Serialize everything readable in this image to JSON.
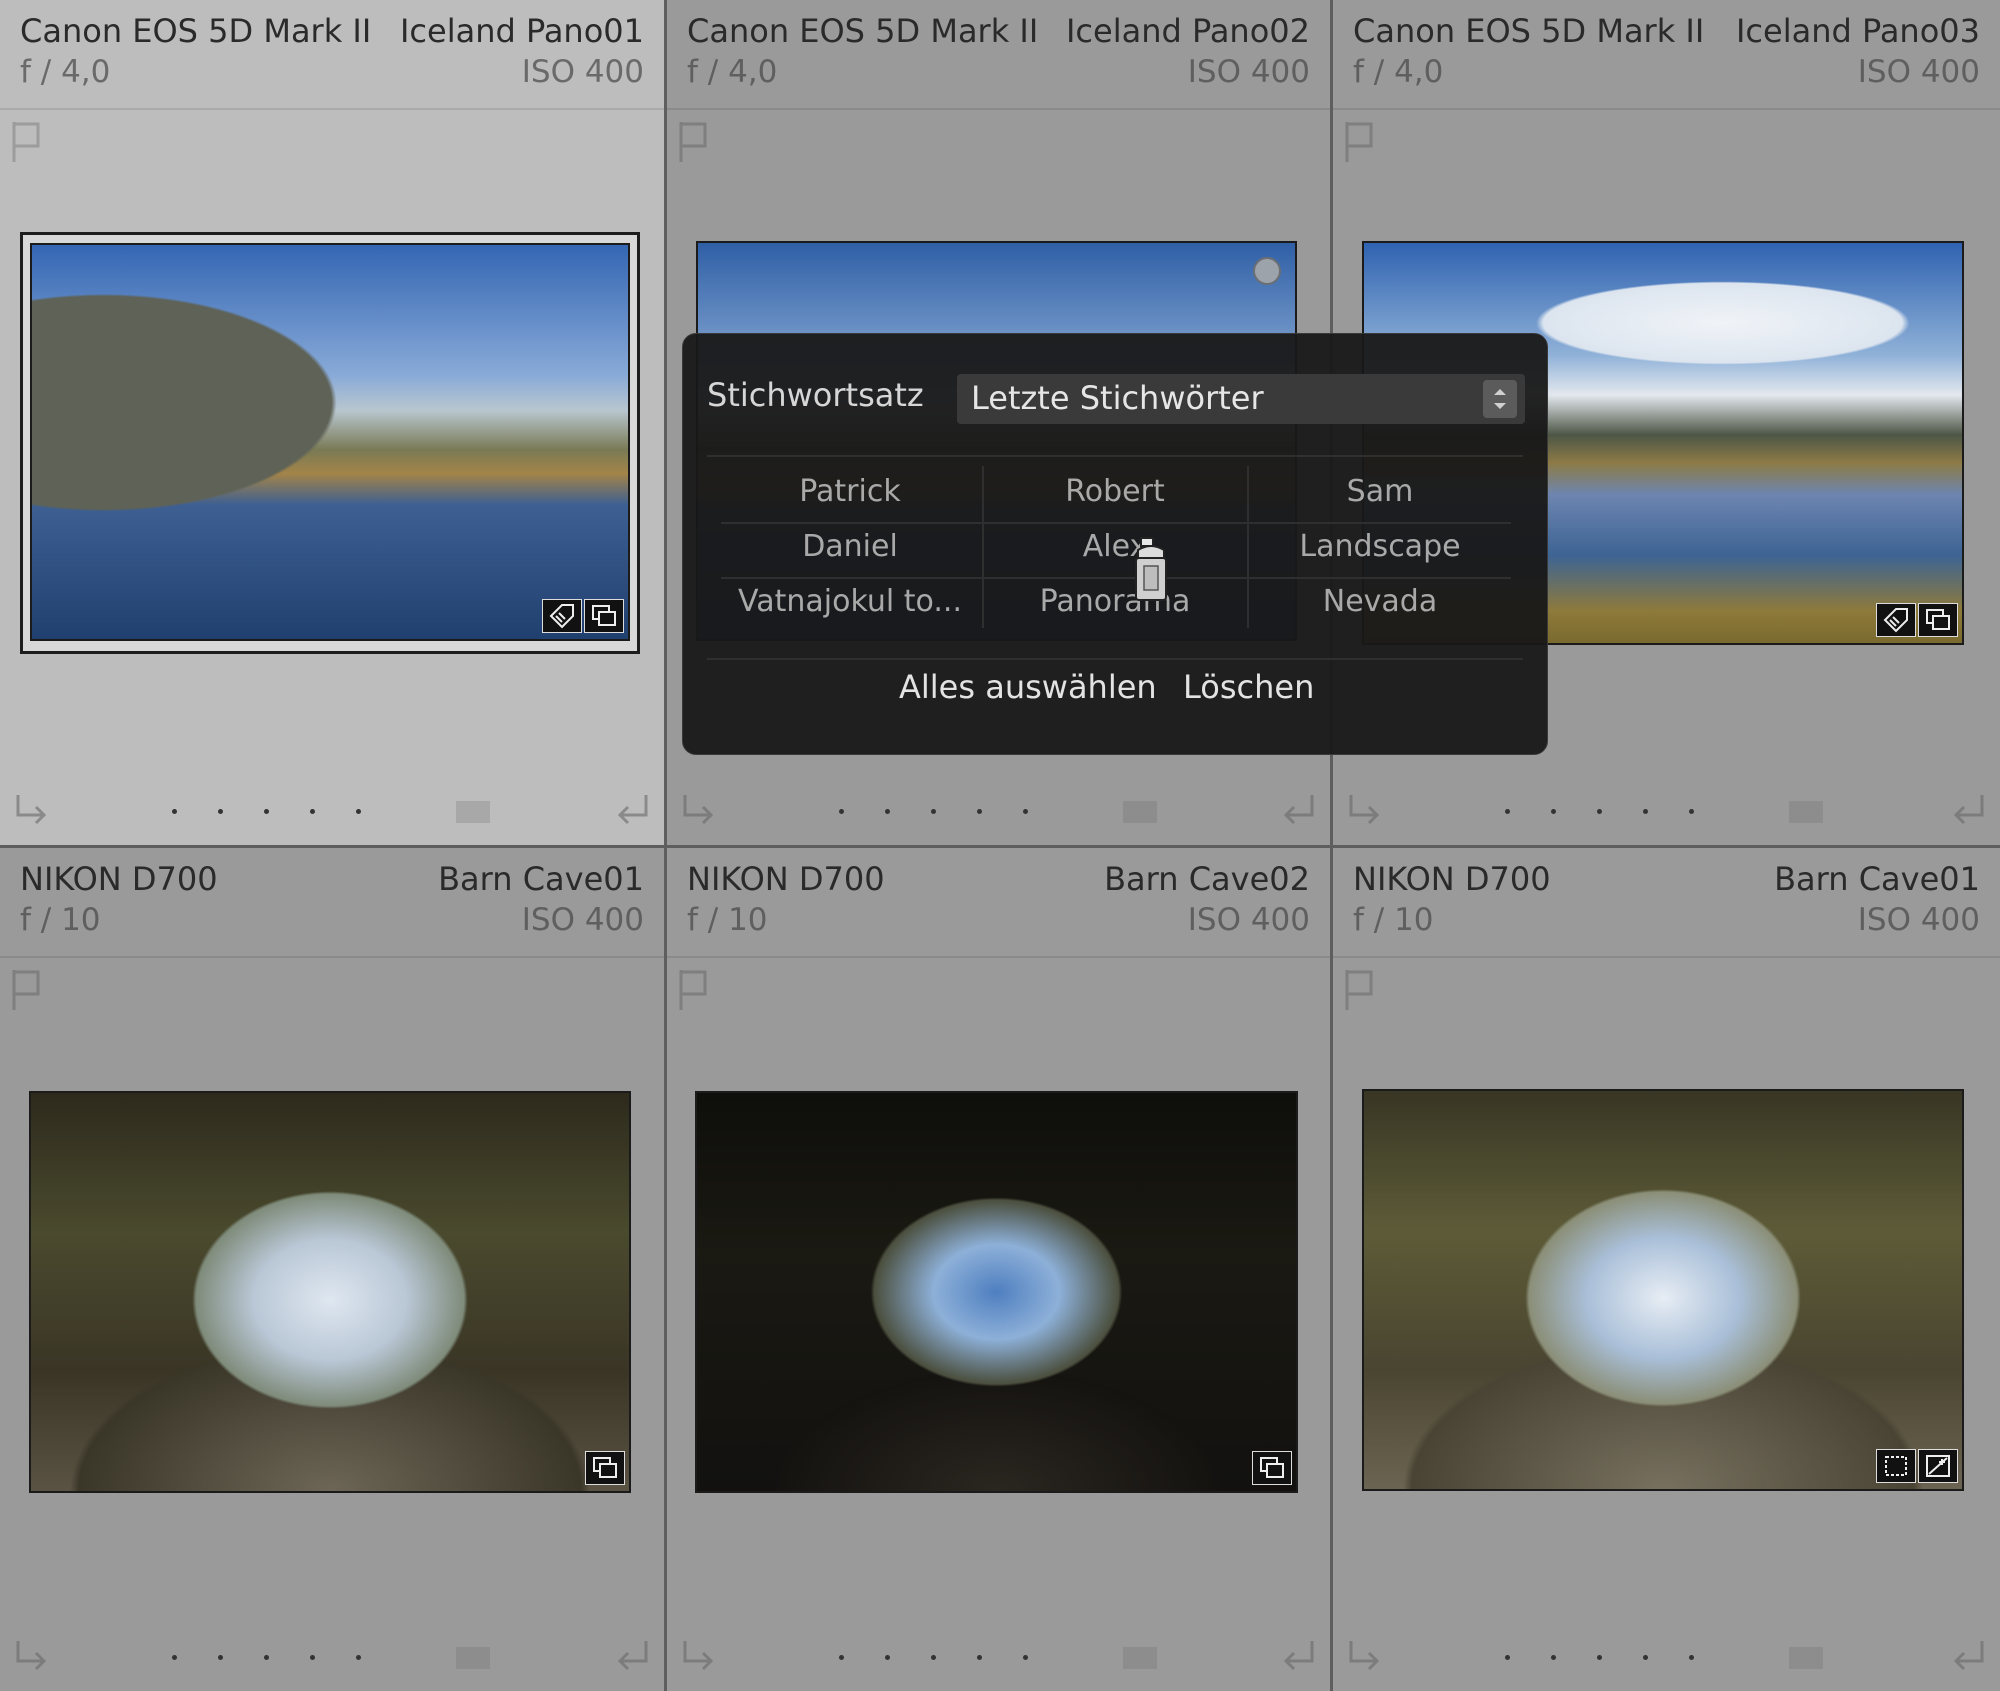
{
  "grid": {
    "cells": [
      {
        "camera": "Canon EOS 5D Mark II",
        "name": "Iceland Pano01",
        "aperture": "f / 4,0",
        "iso": "ISO 400"
      },
      {
        "camera": "Canon EOS 5D Mark II",
        "name": "Iceland Pano02",
        "aperture": "f / 4,0",
        "iso": "ISO 400"
      },
      {
        "camera": "Canon EOS 5D Mark II",
        "name": "Iceland Pano03",
        "aperture": "f / 4,0",
        "iso": "ISO 400"
      },
      {
        "camera": "NIKON D700",
        "name": "Barn Cave01",
        "aperture": "f / 10",
        "iso": "ISO 400"
      },
      {
        "camera": "NIKON D700",
        "name": "Barn Cave02",
        "aperture": "f / 10",
        "iso": "ISO 400"
      },
      {
        "camera": "NIKON D700",
        "name": "Barn Cave01",
        "aperture": "f / 10",
        "iso": "ISO 400"
      }
    ]
  },
  "keyword_popup": {
    "label": "Stichwortsatz",
    "set_value": "Letzte Stichwörter",
    "keywords": [
      "Patrick",
      "Robert",
      "Sam",
      "Daniel",
      "Alex",
      "Landscape",
      "Vatnajokul to...",
      "Panorama",
      "Nevada"
    ],
    "select_all": "Alles auswählen",
    "delete": "Löschen"
  },
  "icons": [
    "flag-icon",
    "rotate-left-icon",
    "rotate-right-icon",
    "keyword-tag-icon",
    "virtual-copy-icon",
    "crop-icon",
    "develop-adjusted-icon",
    "painter-spray-can-icon"
  ]
}
